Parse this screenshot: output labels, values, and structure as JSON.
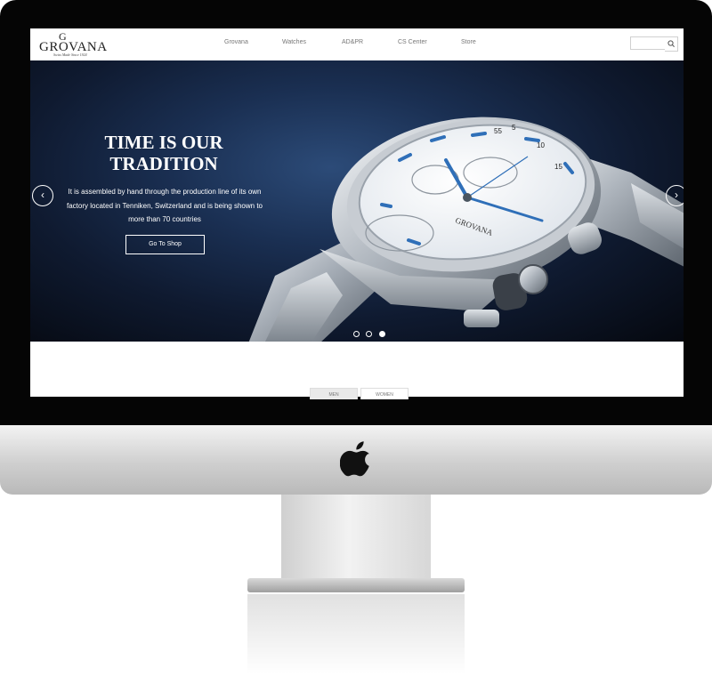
{
  "site": {
    "logo_text": "GROVANA",
    "logo_tagline": "Swiss Made Since 1924",
    "logo_mark": "G"
  },
  "nav": {
    "items": [
      {
        "label": "Grovana"
      },
      {
        "label": "Watches"
      },
      {
        "label": "AD&PR"
      },
      {
        "label": "CS Center"
      },
      {
        "label": "Store"
      }
    ],
    "search_placeholder": ""
  },
  "hero": {
    "headline_line1": "TIME IS OUR",
    "headline_line2": "TRADITION",
    "description": "It is assembled by hand through the production line of its own factory located in Tenniken, Switzerland and is being shown to more than 70 countries",
    "cta_label": "Go To Shop",
    "slides_total": 3,
    "active_slide": 3,
    "watch_brand_on_dial": "GROVANA",
    "dial_numerals": [
      "55",
      "5",
      "10",
      "15"
    ]
  },
  "tabs": [
    {
      "label": "MEN",
      "active": true
    },
    {
      "label": "WOMEN",
      "active": false
    }
  ],
  "icons": {
    "prev": "chevron-left-icon",
    "next": "chevron-right-icon",
    "search": "search-icon",
    "hardware_logo": "apple-icon"
  },
  "colors": {
    "hero_dark": "#0f1a30",
    "hero_blue": "#2c4b78",
    "watch_hand_blue": "#2f6fb8"
  }
}
